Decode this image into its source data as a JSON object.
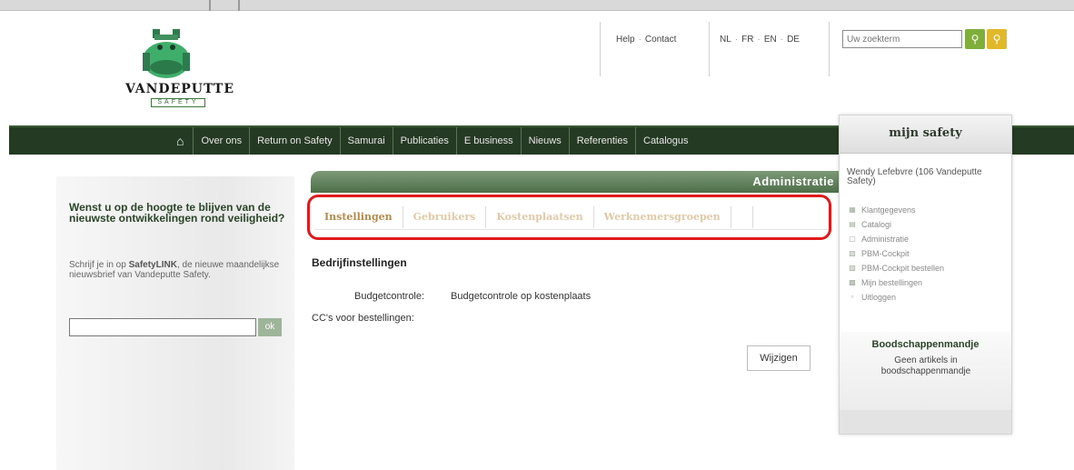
{
  "header": {
    "brand": "VANDEPUTTE",
    "brand_sub": "SAFETY",
    "links": {
      "help": "Help",
      "contact": "Contact"
    },
    "languages": [
      "NL",
      "FR",
      "EN",
      "DE"
    ],
    "search_placeholder": "Uw zoekterm"
  },
  "nav": {
    "items": [
      "Over ons",
      "Return on Safety",
      "Samurai",
      "Publicaties",
      "E business",
      "Nieuws",
      "Referenties",
      "Catalogus"
    ]
  },
  "newsletter": {
    "title": "Wenst u op de hoogte te blijven van de nieuwste ontwikkelingen rond veiligheid?",
    "text_pre": "Schrijf je in op ",
    "text_brand": "SafetyLINK",
    "text_post": ", de nieuwe maandelijkse nieuwsbrief van Vandeputte Safety.",
    "button_label": "ok"
  },
  "admin": {
    "title": "Administratie",
    "tabs": [
      "Instellingen",
      "Gebruikers",
      "Kostenplaatsen",
      "Werknemersgroepen"
    ],
    "section_title": "Bedrijfinstellingen",
    "budget_label": "Budgetcontrole:",
    "budget_value": "Budgetcontrole op kostenplaats",
    "cc_label": "CC's voor bestellingen:",
    "edit_button": "Wijzigen"
  },
  "mijn_safety": {
    "title": "mijn safety",
    "user": "Wendy Lefebvre (106 Vandeputte Safety)",
    "menu": [
      {
        "label": "Klantgegevens",
        "icon": "users-icon"
      },
      {
        "label": "Catalogi",
        "icon": "book-icon"
      },
      {
        "label": "Administratie",
        "icon": "document-icon"
      },
      {
        "label": "PBM-Cockpit",
        "icon": "people-icon"
      },
      {
        "label": "PBM-Cockpit bestellen",
        "icon": "order-icon"
      },
      {
        "label": "Mijn bestellingen",
        "icon": "chart-icon"
      },
      {
        "label": "Uitloggen",
        "icon": "logout-icon"
      }
    ],
    "basket_title": "Boodschappenmandje",
    "basket_text": "Geen artikels in boodschappenmandje"
  },
  "colors": {
    "nav_bg": "#253a22",
    "accent_green": "#2a4527",
    "tab_active": "#b48a4b",
    "highlight_red": "#e01a1a"
  }
}
